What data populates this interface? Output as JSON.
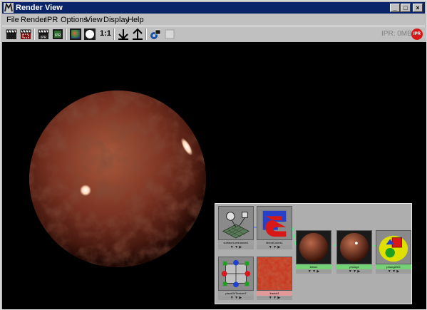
{
  "window": {
    "title": "Render View"
  },
  "title_buttons": {
    "minimize": "_",
    "maximize": "□",
    "close": "×"
  },
  "menu": [
    "File",
    "Render",
    "IPR",
    "Options",
    "View",
    "Display",
    "Help"
  ],
  "toolbar": {
    "ratio_label": "1:1",
    "ipr_memory": "IPR: 0MB",
    "ipr_badge": "IPR",
    "ipr_button_label": "IPR"
  },
  "hypergraph": {
    "nodes": [
      {
        "label": "surfaceLuminance1"
      },
      {
        "label": "blendColors1"
      },
      {
        "label": "blinn1"
      },
      {
        "label": "phong1"
      },
      {
        "label": "phong1SG"
      },
      {
        "label": "place2dTexture1"
      },
      {
        "label": "fractal1"
      }
    ],
    "arrows": "▼ ▼ ▶"
  },
  "colors": {
    "title_bar": "#0a246a",
    "render_background": "#000000",
    "ipr_badge": "#d81818",
    "node_label_green": "#76d276",
    "node_label_pink": "#e09a9a"
  }
}
